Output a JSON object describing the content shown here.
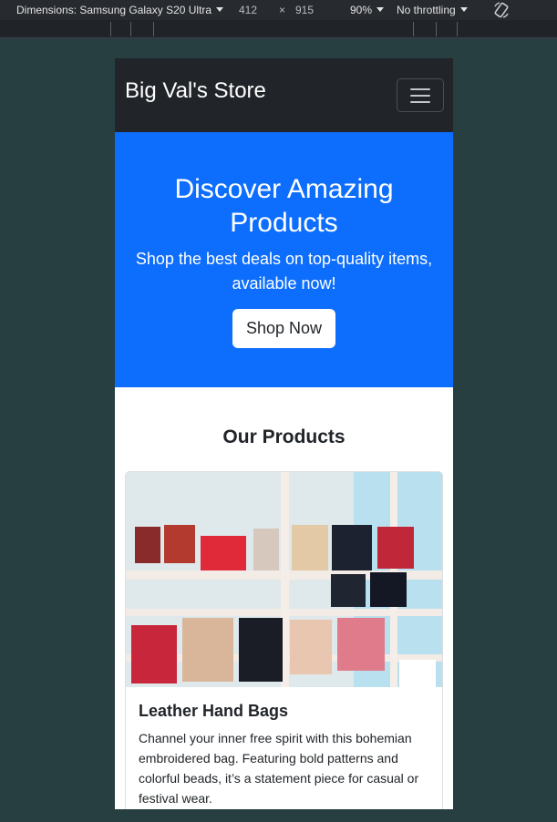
{
  "devtools": {
    "dimensions_label": "Dimensions: Samsung Galaxy S20 Ultra",
    "width": "412",
    "times": "×",
    "height": "915",
    "zoom": "90%",
    "throttling": "No throttling",
    "rotate_icon": "rotate-icon"
  },
  "navbar": {
    "brand": "Big Val's Store",
    "toggler_icon": "hamburger-icon"
  },
  "hero": {
    "title": "Discover Amazing Products",
    "subtitle": "Shop the best deals on top-quality items, available now!",
    "button_label": "Shop Now"
  },
  "products": {
    "title": "Our Products",
    "items": [
      {
        "title": "Leather Hand Bags",
        "description": "Channel your inner free spirit with this bohemian embroidered bag. Featuring bold patterns and colorful beads, it’s a statement piece for casual or festival wear."
      }
    ]
  },
  "colors": {
    "page_bg": "#283f42",
    "navbar_bg": "#212529",
    "hero_bg": "#0d6efd"
  }
}
